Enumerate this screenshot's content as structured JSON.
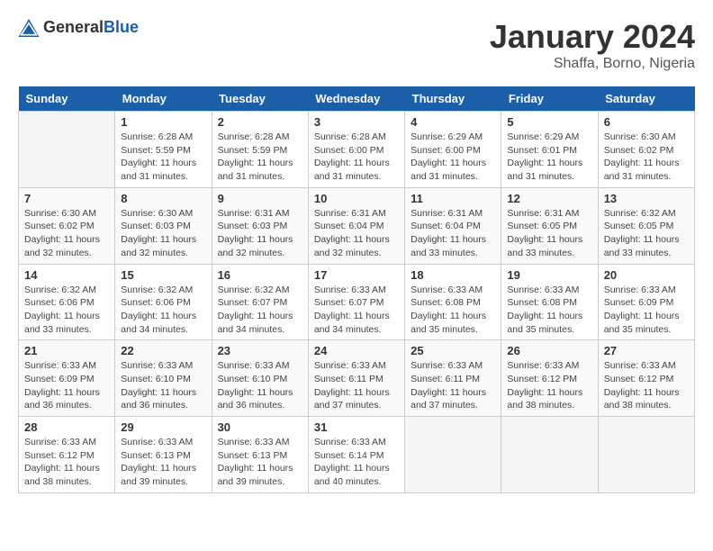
{
  "header": {
    "logo_general": "General",
    "logo_blue": "Blue",
    "month_title": "January 2024",
    "location": "Shaffa, Borno, Nigeria"
  },
  "days_of_week": [
    "Sunday",
    "Monday",
    "Tuesday",
    "Wednesday",
    "Thursday",
    "Friday",
    "Saturday"
  ],
  "weeks": [
    [
      {
        "day": "",
        "info": ""
      },
      {
        "day": "1",
        "info": "Sunrise: 6:28 AM\nSunset: 5:59 PM\nDaylight: 11 hours\nand 31 minutes."
      },
      {
        "day": "2",
        "info": "Sunrise: 6:28 AM\nSunset: 5:59 PM\nDaylight: 11 hours\nand 31 minutes."
      },
      {
        "day": "3",
        "info": "Sunrise: 6:28 AM\nSunset: 6:00 PM\nDaylight: 11 hours\nand 31 minutes."
      },
      {
        "day": "4",
        "info": "Sunrise: 6:29 AM\nSunset: 6:00 PM\nDaylight: 11 hours\nand 31 minutes."
      },
      {
        "day": "5",
        "info": "Sunrise: 6:29 AM\nSunset: 6:01 PM\nDaylight: 11 hours\nand 31 minutes."
      },
      {
        "day": "6",
        "info": "Sunrise: 6:30 AM\nSunset: 6:02 PM\nDaylight: 11 hours\nand 31 minutes."
      }
    ],
    [
      {
        "day": "7",
        "info": "Sunrise: 6:30 AM\nSunset: 6:02 PM\nDaylight: 11 hours\nand 32 minutes."
      },
      {
        "day": "8",
        "info": "Sunrise: 6:30 AM\nSunset: 6:03 PM\nDaylight: 11 hours\nand 32 minutes."
      },
      {
        "day": "9",
        "info": "Sunrise: 6:31 AM\nSunset: 6:03 PM\nDaylight: 11 hours\nand 32 minutes."
      },
      {
        "day": "10",
        "info": "Sunrise: 6:31 AM\nSunset: 6:04 PM\nDaylight: 11 hours\nand 32 minutes."
      },
      {
        "day": "11",
        "info": "Sunrise: 6:31 AM\nSunset: 6:04 PM\nDaylight: 11 hours\nand 33 minutes."
      },
      {
        "day": "12",
        "info": "Sunrise: 6:31 AM\nSunset: 6:05 PM\nDaylight: 11 hours\nand 33 minutes."
      },
      {
        "day": "13",
        "info": "Sunrise: 6:32 AM\nSunset: 6:05 PM\nDaylight: 11 hours\nand 33 minutes."
      }
    ],
    [
      {
        "day": "14",
        "info": "Sunrise: 6:32 AM\nSunset: 6:06 PM\nDaylight: 11 hours\nand 33 minutes."
      },
      {
        "day": "15",
        "info": "Sunrise: 6:32 AM\nSunset: 6:06 PM\nDaylight: 11 hours\nand 34 minutes."
      },
      {
        "day": "16",
        "info": "Sunrise: 6:32 AM\nSunset: 6:07 PM\nDaylight: 11 hours\nand 34 minutes."
      },
      {
        "day": "17",
        "info": "Sunrise: 6:33 AM\nSunset: 6:07 PM\nDaylight: 11 hours\nand 34 minutes."
      },
      {
        "day": "18",
        "info": "Sunrise: 6:33 AM\nSunset: 6:08 PM\nDaylight: 11 hours\nand 35 minutes."
      },
      {
        "day": "19",
        "info": "Sunrise: 6:33 AM\nSunset: 6:08 PM\nDaylight: 11 hours\nand 35 minutes."
      },
      {
        "day": "20",
        "info": "Sunrise: 6:33 AM\nSunset: 6:09 PM\nDaylight: 11 hours\nand 35 minutes."
      }
    ],
    [
      {
        "day": "21",
        "info": "Sunrise: 6:33 AM\nSunset: 6:09 PM\nDaylight: 11 hours\nand 36 minutes."
      },
      {
        "day": "22",
        "info": "Sunrise: 6:33 AM\nSunset: 6:10 PM\nDaylight: 11 hours\nand 36 minutes."
      },
      {
        "day": "23",
        "info": "Sunrise: 6:33 AM\nSunset: 6:10 PM\nDaylight: 11 hours\nand 36 minutes."
      },
      {
        "day": "24",
        "info": "Sunrise: 6:33 AM\nSunset: 6:11 PM\nDaylight: 11 hours\nand 37 minutes."
      },
      {
        "day": "25",
        "info": "Sunrise: 6:33 AM\nSunset: 6:11 PM\nDaylight: 11 hours\nand 37 minutes."
      },
      {
        "day": "26",
        "info": "Sunrise: 6:33 AM\nSunset: 6:12 PM\nDaylight: 11 hours\nand 38 minutes."
      },
      {
        "day": "27",
        "info": "Sunrise: 6:33 AM\nSunset: 6:12 PM\nDaylight: 11 hours\nand 38 minutes."
      }
    ],
    [
      {
        "day": "28",
        "info": "Sunrise: 6:33 AM\nSunset: 6:12 PM\nDaylight: 11 hours\nand 38 minutes."
      },
      {
        "day": "29",
        "info": "Sunrise: 6:33 AM\nSunset: 6:13 PM\nDaylight: 11 hours\nand 39 minutes."
      },
      {
        "day": "30",
        "info": "Sunrise: 6:33 AM\nSunset: 6:13 PM\nDaylight: 11 hours\nand 39 minutes."
      },
      {
        "day": "31",
        "info": "Sunrise: 6:33 AM\nSunset: 6:14 PM\nDaylight: 11 hours\nand 40 minutes."
      },
      {
        "day": "",
        "info": ""
      },
      {
        "day": "",
        "info": ""
      },
      {
        "day": "",
        "info": ""
      }
    ]
  ]
}
